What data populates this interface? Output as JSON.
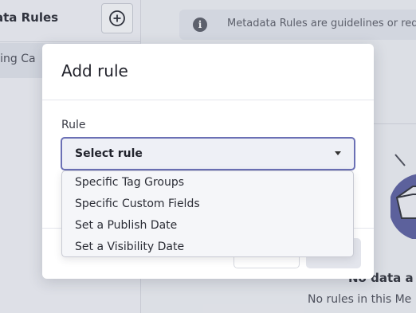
{
  "background": {
    "sidebar_title": "ata Rules",
    "sidebar_item": "eting Ca",
    "info_text": "Metadata Rules are guidelines or req",
    "empty_title": "No data a",
    "empty_subtitle": "No rules in this Me"
  },
  "modal": {
    "title": "Add rule",
    "field_label": "Rule",
    "select_placeholder": "Select rule",
    "options": [
      "Specific Tag Groups",
      "Specific Custom Fields",
      "Set a Publish Date",
      "Set a Visibility Date"
    ]
  },
  "colors": {
    "accent": "#6b70b5",
    "illustration": "#5b5fa0"
  }
}
